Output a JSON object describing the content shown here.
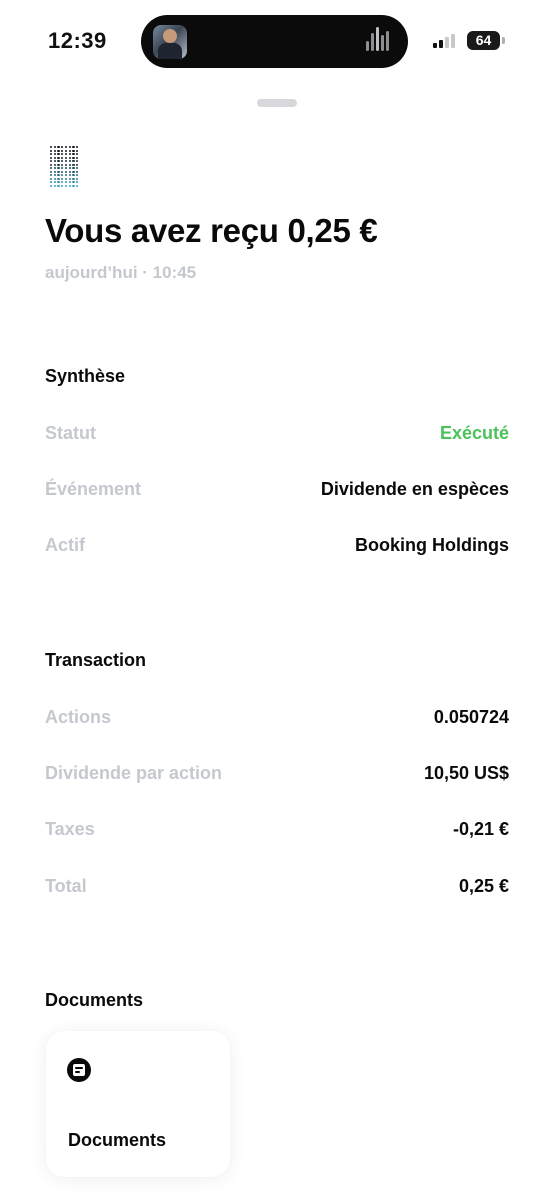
{
  "status_bar": {
    "time": "12:39",
    "battery": "64"
  },
  "header": {
    "logo_icon": "dot-matrix-logo-icon",
    "title": "Vous avez reçu 0,25 €",
    "subtitle": "aujourd’hui · 10:45"
  },
  "synthese": {
    "title": "Synthèse",
    "rows": [
      {
        "label": "Statut",
        "value": "Exécuté",
        "value_color": "#4cc35a"
      },
      {
        "label": "Événement",
        "value": "Dividende en espèces"
      },
      {
        "label": "Actif",
        "value": "Booking Holdings"
      }
    ]
  },
  "transaction": {
    "title": "Transaction",
    "rows": [
      {
        "label": "Actions",
        "value": "0.050724"
      },
      {
        "label": "Dividende par action",
        "value": "10,50 US$"
      },
      {
        "label": "Taxes",
        "value": "-0,21 €"
      },
      {
        "label": "Total",
        "value": "0,25 €"
      }
    ]
  },
  "documents": {
    "title": "Documents",
    "card_icon": "document-icon",
    "card_label": "Documents"
  }
}
